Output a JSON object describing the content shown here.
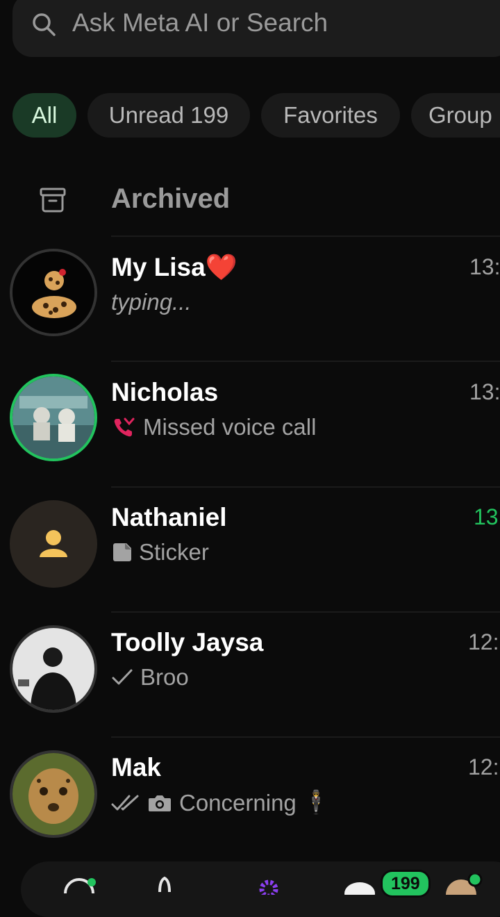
{
  "search": {
    "placeholder": "Ask Meta AI or Search"
  },
  "filters": [
    "All",
    "Unread 199",
    "Favorites",
    "Group"
  ],
  "archived": {
    "label": "Archived"
  },
  "chats": [
    {
      "name": "My Lisa",
      "emoji": "❤️",
      "preview": "typing...",
      "time": "13:"
    },
    {
      "name": "Nicholas",
      "preview": "Missed voice call",
      "time": "13:"
    },
    {
      "name": "Nathaniel",
      "preview": "Sticker",
      "time": "13"
    },
    {
      "name": "Toolly Jaysa",
      "preview": "Broo",
      "time": "12:"
    },
    {
      "name": "Mak",
      "preview": "Concerning",
      "emoji": "🕴",
      "time": "12:"
    }
  ],
  "bottom_nav": {
    "chats_badge": "199"
  },
  "colors": {
    "accent": "#22c35e",
    "background": "#0b0b0b",
    "missed_call": "#e0245e"
  }
}
